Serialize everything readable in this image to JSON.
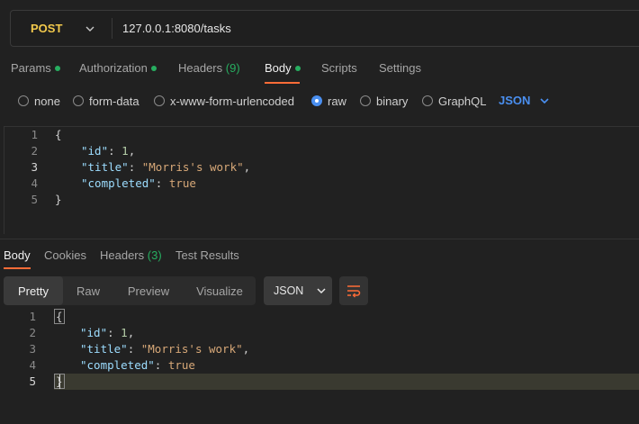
{
  "request": {
    "method": "POST",
    "url": "127.0.0.1:8080/tasks"
  },
  "request_tabs": [
    {
      "label": "Params",
      "dot": true
    },
    {
      "label": "Authorization",
      "dot": true
    },
    {
      "label": "Headers",
      "count": "(9)"
    },
    {
      "label": "Body",
      "dot": true,
      "active": true
    },
    {
      "label": "Scripts"
    },
    {
      "label": "Settings"
    }
  ],
  "body_types": [
    {
      "label": "none",
      "checked": false
    },
    {
      "label": "form-data",
      "checked": false
    },
    {
      "label": "x-www-form-urlencoded",
      "checked": false
    },
    {
      "label": "raw",
      "checked": true
    },
    {
      "label": "binary",
      "checked": false
    },
    {
      "label": "GraphQL",
      "checked": false
    }
  ],
  "body_language": "JSON",
  "request_body": {
    "line_numbers": [
      "1",
      "2",
      "3",
      "4",
      "5"
    ],
    "open_brace": "{",
    "close_brace": "}",
    "id_key": "\"id\"",
    "id_value": "1",
    "title_key": "\"title\"",
    "title_value": "\"Morris's work\"",
    "completed_key": "\"completed\"",
    "completed_value": "true"
  },
  "response_tabs": [
    {
      "label": "Body",
      "active": true
    },
    {
      "label": "Cookies"
    },
    {
      "label": "Headers",
      "count": "(3)"
    },
    {
      "label": "Test Results"
    }
  ],
  "response_formats": [
    {
      "label": "Pretty",
      "active": true
    },
    {
      "label": "Raw"
    },
    {
      "label": "Preview"
    },
    {
      "label": "Visualize"
    }
  ],
  "response_language": "JSON",
  "response_body": {
    "line_numbers": [
      "1",
      "2",
      "3",
      "4",
      "5"
    ],
    "open_brace": "{",
    "close_brace": "}",
    "id_key": "\"id\"",
    "id_value": "1",
    "title_key": "\"title\"",
    "title_value": "\"Morris's work\"",
    "completed_key": "\"completed\"",
    "completed_value": "true"
  },
  "colors": {
    "accent": "#ff6c37",
    "method": "#f2c94c",
    "link_blue": "#4a8ff0",
    "status_green": "#27ae60"
  },
  "icons": {
    "method_dropdown": "chevron-down-icon",
    "language_dropdown": "chevron-down-icon",
    "wrap": "wrap-lines-icon"
  }
}
